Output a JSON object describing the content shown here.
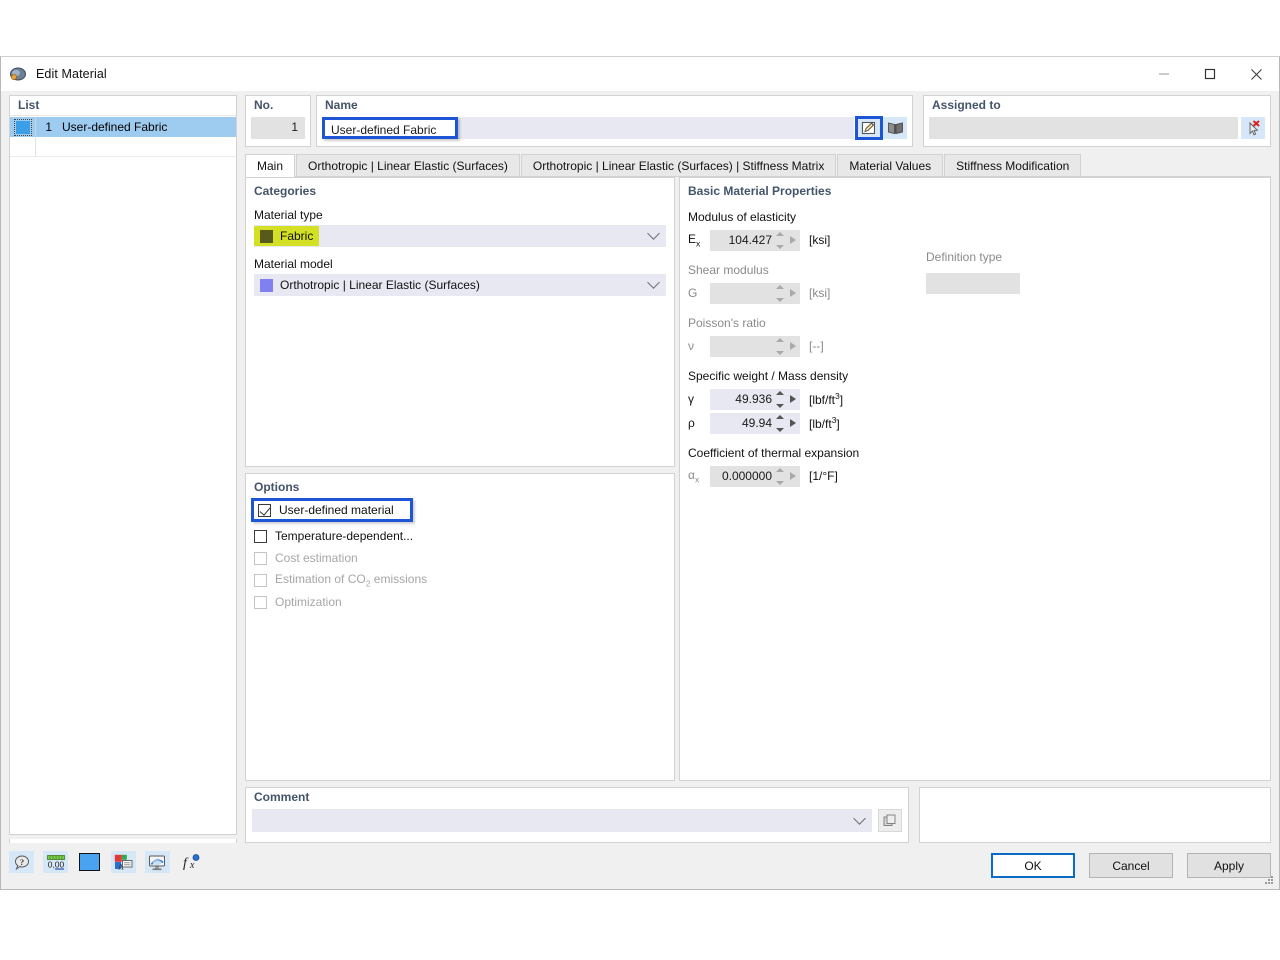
{
  "window": {
    "title": "Edit Material",
    "app_icon": "material-icon",
    "minimize": "minimize-icon",
    "maximize": "maximize-icon",
    "close": "close-icon"
  },
  "list": {
    "header": "List",
    "rows": [
      {
        "no": "1",
        "name": "User-defined Fabric",
        "color": "#3b9fe8",
        "selected": true
      }
    ],
    "toolbar": [
      {
        "name": "new-material-button",
        "icon": "new-window-icon",
        "enabled": true
      },
      {
        "name": "copy-material-button",
        "icon": "copy-window-icon",
        "enabled": true
      },
      {
        "name": "select-all-button",
        "icon": "check-list-icon",
        "enabled": false
      },
      {
        "name": "deselect-button",
        "icon": "uncheck-list-icon",
        "enabled": false
      },
      {
        "name": "delete-material-button",
        "icon": "red-x-icon",
        "enabled": true,
        "glyph": "✕"
      }
    ]
  },
  "header": {
    "no_label": "No.",
    "no_value": "1",
    "name_label": "Name",
    "name_value": "User-defined Fabric",
    "name_edit_button": "edit-pencil-icon",
    "name_library_button": "library-book-icon",
    "assigned_label": "Assigned to",
    "assigned_value": "",
    "assigned_pick_button": "deselect-cursor-icon"
  },
  "tabs": [
    {
      "label": "Main",
      "active": true
    },
    {
      "label": "Orthotropic | Linear Elastic (Surfaces)",
      "active": false
    },
    {
      "label": "Orthotropic | Linear Elastic (Surfaces) | Stiffness Matrix",
      "active": false
    },
    {
      "label": "Material Values",
      "active": false
    },
    {
      "label": "Stiffness Modification",
      "active": false
    }
  ],
  "categories": {
    "title": "Categories",
    "material_type_label": "Material type",
    "material_type_value": "Fabric",
    "material_type_swatch": "#565b1b",
    "material_type_highlight": "#d4e023",
    "material_model_label": "Material model",
    "material_model_value": "Orthotropic | Linear Elastic (Surfaces)",
    "material_model_swatch": "#8080f0"
  },
  "options": {
    "title": "Options",
    "items": [
      {
        "label": "User-defined material",
        "checked": true,
        "enabled": true,
        "focused": true
      },
      {
        "label": "Temperature-dependent...",
        "checked": false,
        "enabled": true,
        "focused": false
      },
      {
        "label": "Cost estimation",
        "checked": false,
        "enabled": false,
        "focused": false
      },
      {
        "label": "Estimation of CO2 emissions",
        "checked": false,
        "enabled": false,
        "focused": false
      },
      {
        "label": "Optimization",
        "checked": false,
        "enabled": false,
        "focused": false
      }
    ]
  },
  "properties": {
    "title": "Basic Material Properties",
    "modulus_label": "Modulus of elasticity",
    "modulus_symbol": "E",
    "modulus_symbol_sub": "x",
    "modulus_value": "104.427",
    "modulus_unit": "[ksi]",
    "shear_label": "Shear modulus",
    "shear_symbol": "G",
    "shear_value": "",
    "shear_unit": "[ksi]",
    "definition_type_label": "Definition type",
    "definition_type_value": "",
    "poisson_label": "Poisson's ratio",
    "poisson_symbol": "ν",
    "poisson_value": "",
    "poisson_unit": "[--]",
    "density_label": "Specific weight / Mass density",
    "gamma_symbol": "γ",
    "gamma_value": "49.936",
    "gamma_unit_base": "[lbf/ft",
    "gamma_unit_sup": "3",
    "gamma_unit_end": "]",
    "rho_symbol": "ρ",
    "rho_value": "49.94",
    "rho_unit_base": "[lb/ft",
    "rho_unit_sup": "3",
    "rho_unit_end": "]",
    "thermal_label": "Coefficient of thermal expansion",
    "alpha_symbol": "α",
    "alpha_symbol_sub": "x",
    "alpha_value": "0.000000",
    "alpha_unit": "[1/°F]"
  },
  "comment": {
    "label": "Comment",
    "value": "",
    "placeholder": "",
    "button": "comment-templates-icon"
  },
  "bottom_toolbar": [
    {
      "name": "help-info-button",
      "icon": "info-bubble-icon"
    },
    {
      "name": "decimal-places-button",
      "icon": "numeric-format-icon"
    },
    {
      "name": "color-button",
      "icon": "color-swatch-icon",
      "color": "#4aa3f0"
    },
    {
      "name": "display-properties-button",
      "icon": "display-props-icon"
    },
    {
      "name": "graphic-print-button",
      "icon": "screen-print-icon"
    },
    {
      "name": "formula-button",
      "icon": "fx-icon"
    }
  ],
  "dialog_buttons": {
    "ok": "OK",
    "cancel": "Cancel",
    "apply": "Apply"
  },
  "colors": {
    "accent_blue": "#1d55d6",
    "primary_button_border": "#0a6cc4",
    "group_title": "#44546a",
    "field_editable": "#e7e8f2",
    "field_readonly": "#e2e2e2",
    "selection": "#9ecbf0"
  }
}
